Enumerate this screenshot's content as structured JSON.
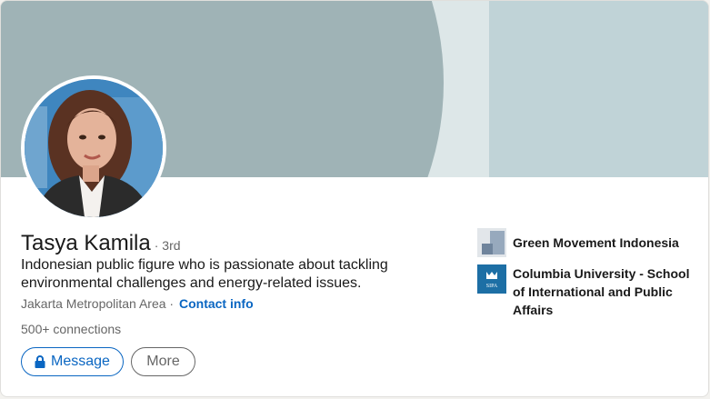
{
  "profile": {
    "name": "Tasya Kamila",
    "degree": "· 3rd",
    "headline": "Indonesian public figure who is passionate about tackling environmental challenges and energy-related issues.",
    "location": "Jakarta Metropolitan Area ·",
    "contact_label": "Contact info",
    "connections": "500+ connections"
  },
  "actions": {
    "message_label": "Message",
    "more_label": "More",
    "message_icon": "lock-icon"
  },
  "organizations": [
    {
      "name": "Green Movement Indonesia",
      "logo": "green-movement-logo"
    },
    {
      "name": "Columbia University - School of International and Public Affairs",
      "logo": "columbia-sipa-logo",
      "logo_text": "SIPA"
    }
  ],
  "colors": {
    "primary": "#0a66c2",
    "text": "#191919",
    "muted": "#666666",
    "banner_dark": "#9fb3b6",
    "banner_light": "#dde7e8",
    "banner_right": "#c0d3d7"
  }
}
